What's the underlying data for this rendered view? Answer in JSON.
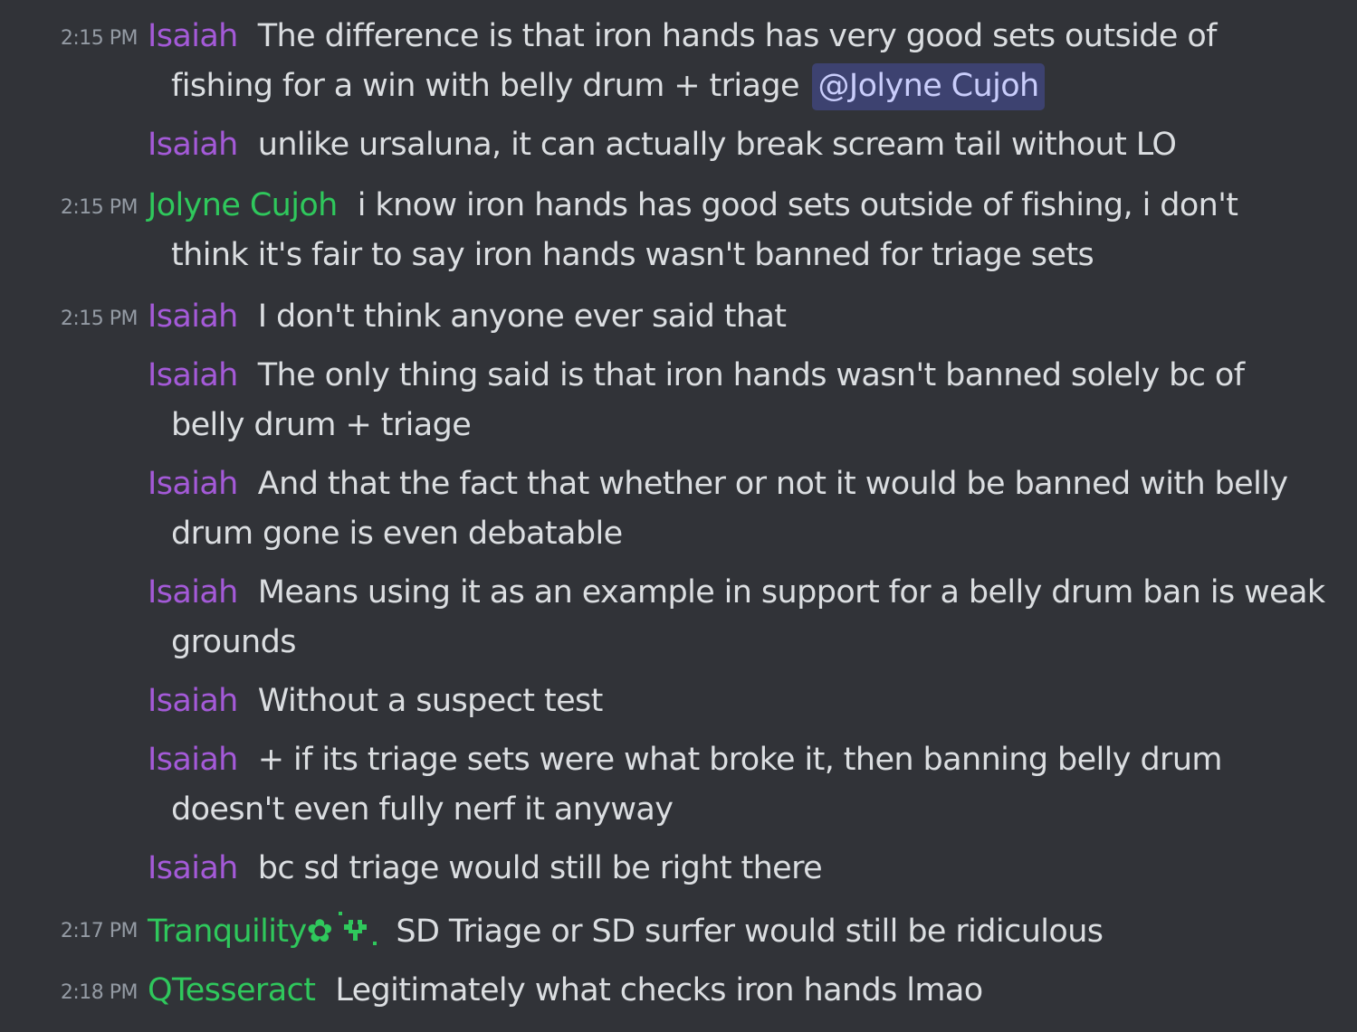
{
  "colors": {
    "background": "#313338",
    "text": "#dbdee1",
    "timestamp": "#949ba4",
    "user_purple": "#a45ad8",
    "user_green": "#2fc85c",
    "mention_bg": "#3d4270",
    "mention_text": "#c9cdfb"
  },
  "messages": [
    {
      "time": "2:15 PM",
      "user": "Isaiah",
      "line1": "The difference is that iron hands has very good sets outside of",
      "line2": "fishing for a win with belly drum + triage",
      "mention": "@Jolyne Cujoh"
    },
    {
      "user": "Isaiah",
      "line1": "unlike ursaluna, it can actually break scream tail without LO"
    },
    {
      "time": "2:15 PM",
      "user": "Jolyne Cujoh",
      "line1": "i know iron hands has good sets outside of fishing, i don't",
      "line2": "think it's fair to say iron hands wasn't banned for triage sets"
    },
    {
      "time": "2:15 PM",
      "user": "Isaiah",
      "line1": "I don't think anyone ever said that"
    },
    {
      "user": "Isaiah",
      "line1": "The only thing said is that iron hands wasn't banned solely bc of",
      "line2": "belly drum + triage"
    },
    {
      "user": "Isaiah",
      "line1": "And that the fact that whether or not it would be banned with belly",
      "line2": "drum gone is even debatable"
    },
    {
      "user": "Isaiah",
      "line1": "Means using it as an example in support for a belly drum ban is weak",
      "line2": "grounds"
    },
    {
      "user": "Isaiah",
      "line1": "Without a suspect test"
    },
    {
      "user": "Isaiah",
      "line1": "+ if its triage sets were what broke it, then banning belly drum",
      "line2": "doesn't even fully nerf it anyway"
    },
    {
      "user": "Isaiah",
      "line1": "bc sd triage would still be right there"
    },
    {
      "time": "2:17 PM",
      "user": "Tranquility",
      "user_flower": "✿",
      "badge_icon": "plant-badge-icon",
      "line1": "SD Triage or SD surfer would still be ridiculous"
    },
    {
      "time": "2:18 PM",
      "user": "QTesseract",
      "line1": "Legitimately what checks iron hands lmao"
    }
  ]
}
